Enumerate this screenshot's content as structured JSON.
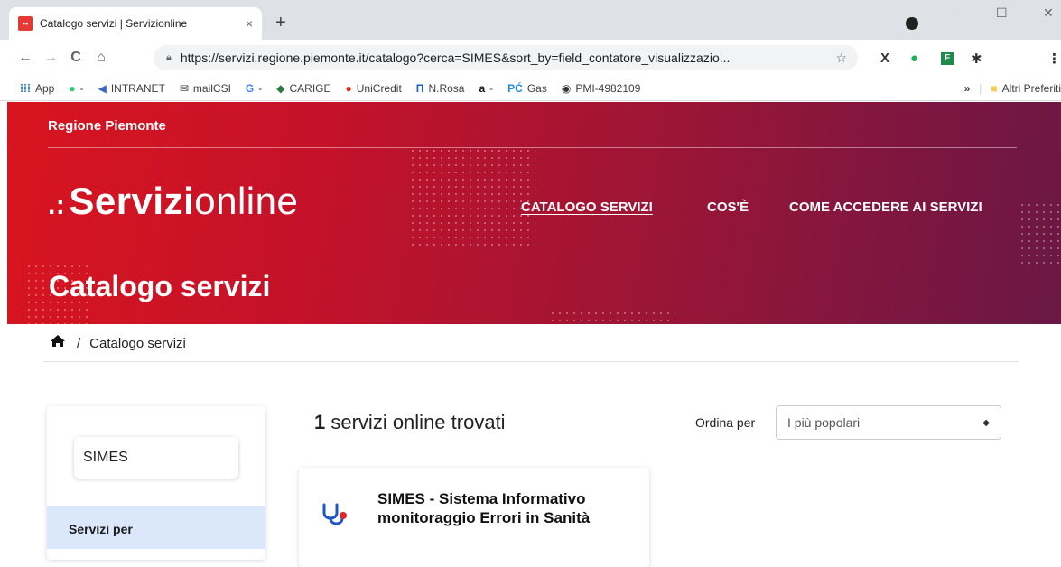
{
  "browser": {
    "tab_title": "Catalogo servizi | Servizionline",
    "tab_close": "×",
    "new_tab": "+",
    "url": "https://servizi.regione.piemonte.it/catalogo?cerca=SIMES&sort_by=field_contatore_visualizzazio...",
    "bookmarks": [
      "App",
      "-",
      "INTRANET",
      "mailCSI",
      "-",
      "CARIGE",
      "UniCredit",
      "N.Rosa",
      "-",
      "Gas",
      "PMI-4982109"
    ],
    "bookmarks_more": "»",
    "other_bookmarks": "Altri Preferiti"
  },
  "header": {
    "region": "Regione Piemonte",
    "logo_bold": "Servizi",
    "logo_light": "online",
    "nav": [
      "CATALOGO SERVIZI",
      "COS'È",
      "COME ACCEDERE AI SERVIZI"
    ],
    "page_title": "Catalogo servizi"
  },
  "breadcrumb": {
    "separator": "/",
    "current": "Catalogo servizi"
  },
  "sidebar": {
    "search_value": "SIMES",
    "section_label": "Servizi per"
  },
  "results": {
    "count": "1",
    "count_text": "servizi online trovati",
    "sort_label": "Ordina per",
    "sort_selected": "I più popolari"
  },
  "cards": [
    {
      "title": "SIMES - Sistema Informativo monitoraggio Errori in Sanità"
    }
  ],
  "colors": {
    "hero_start": "#d8151f",
    "hero_end": "#6a1844",
    "sidebar_active": "#dbe8fb",
    "card_icon_blue": "#1e56c7",
    "card_icon_red": "#d92b2b"
  }
}
